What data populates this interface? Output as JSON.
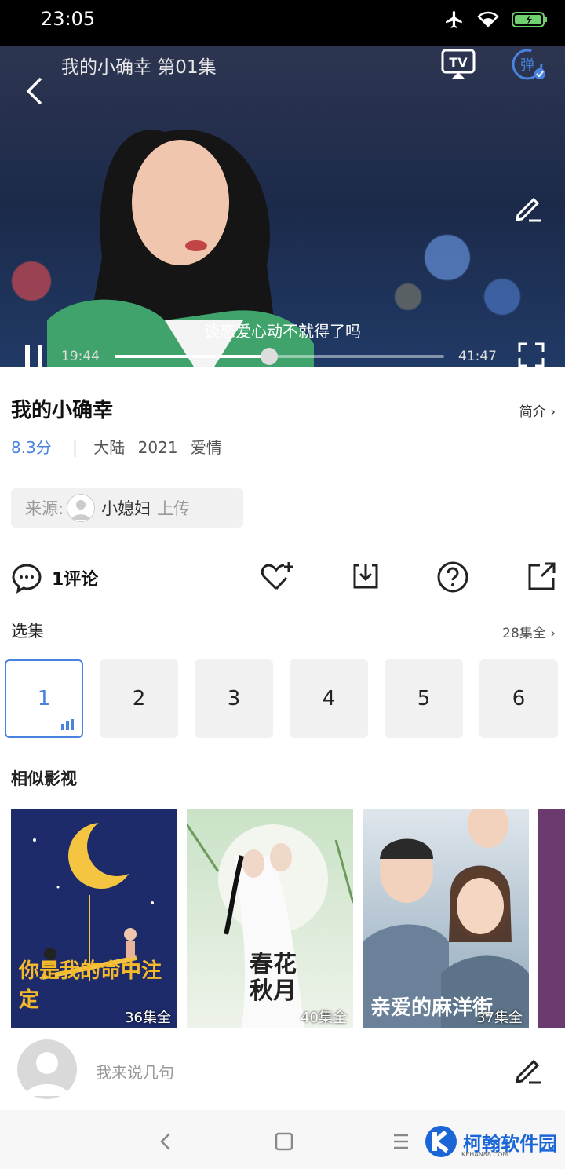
{
  "status_bar": {
    "time": "23:05"
  },
  "player": {
    "title": "我的小确幸 第01集",
    "subtitle": "谈恋爱心动不就得了吗",
    "current_time": "19:44",
    "total_time": "41:47",
    "progress": 0.47,
    "tv_label": "TV",
    "danmu_label": "弹"
  },
  "show": {
    "title": "我的小确幸",
    "intro_label": "简介",
    "score": "8.3分",
    "region": "大陆",
    "year": "2021",
    "genre": "爱情"
  },
  "source": {
    "label": "来源:",
    "user": "小媳妇",
    "action": "上传"
  },
  "actions": {
    "comments": "1评论"
  },
  "episodes": {
    "section_title": "选集",
    "total": "28集全",
    "items": [
      "1",
      "2",
      "3",
      "4",
      "5",
      "6"
    ],
    "selected": "1"
  },
  "similar": {
    "section_title": "相似影视",
    "items": [
      {
        "title": "你是我的命中注定",
        "count": "36集全"
      },
      {
        "title": "春花秋月",
        "count": "40集全"
      },
      {
        "title": "亲爱的麻洋街",
        "count": "37集全"
      }
    ]
  },
  "comment_input": {
    "placeholder": "我来说几句"
  },
  "watermark": {
    "text": "柯翰软件园",
    "sub": "KEHAN88.COM"
  },
  "colors": {
    "accent": "#4a82e0",
    "brand": "#1a66d6"
  }
}
